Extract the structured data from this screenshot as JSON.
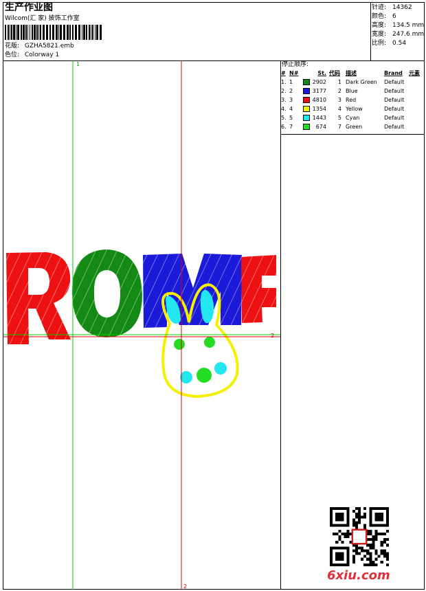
{
  "header": {
    "title": "生产作业图",
    "company": "Wilcom(汇 家) 披饰工作室",
    "design_label": "花版:",
    "design_value": "GZHA5821.emb",
    "colorway_label": "色位:",
    "colorway_value": "Colorway 1"
  },
  "stats": [
    {
      "label": "针迹:",
      "value": "14362"
    },
    {
      "label": "颜色:",
      "value": "6"
    },
    {
      "label": "高度:",
      "value": "134.5 mm"
    },
    {
      "label": "宽度:",
      "value": "247.6 mm"
    },
    {
      "label": "比例:",
      "value": "0.54"
    }
  ],
  "stop_sequence": {
    "title": "停止顺序:",
    "columns": [
      "#",
      "N#",
      "St.",
      "代码",
      "描述",
      "Brand",
      "元素"
    ],
    "rows": [
      {
        "num": "1.",
        "n": "1",
        "color": "#138a13",
        "st": "2902",
        "code": "1",
        "desc": "Dark Green",
        "brand": "Default"
      },
      {
        "num": "2.",
        "n": "2",
        "color": "#1a1ad8",
        "st": "3177",
        "code": "2",
        "desc": "Blue",
        "brand": "Default"
      },
      {
        "num": "3.",
        "n": "3",
        "color": "#ee1111",
        "st": "4810",
        "code": "3",
        "desc": "Red",
        "brand": "Default"
      },
      {
        "num": "4.",
        "n": "4",
        "color": "#f5f000",
        "st": "1354",
        "code": "4",
        "desc": "Yellow",
        "brand": "Default"
      },
      {
        "num": "5.",
        "n": "5",
        "color": "#22e6f0",
        "st": "1443",
        "code": "5",
        "desc": "Cyan",
        "brand": "Default"
      },
      {
        "num": "6.",
        "n": "7",
        "color": "#22dd22",
        "st": "674",
        "code": "7",
        "desc": "Green",
        "brand": "Default"
      }
    ]
  },
  "guides": {
    "green_v_label": "1",
    "red_v_label": "2",
    "green_h_label": "2"
  },
  "colors": {
    "red": "#ee1111",
    "dark_green": "#138a13",
    "blue": "#1a1ad8",
    "yellow": "#f5f000",
    "cyan": "#22e6f0",
    "green": "#22dd22",
    "guide_green": "#00cc00",
    "guide_red": "#dd0000"
  },
  "watermark": {
    "site": "6xiu.com",
    "qr_icon": "qr-code-icon"
  }
}
